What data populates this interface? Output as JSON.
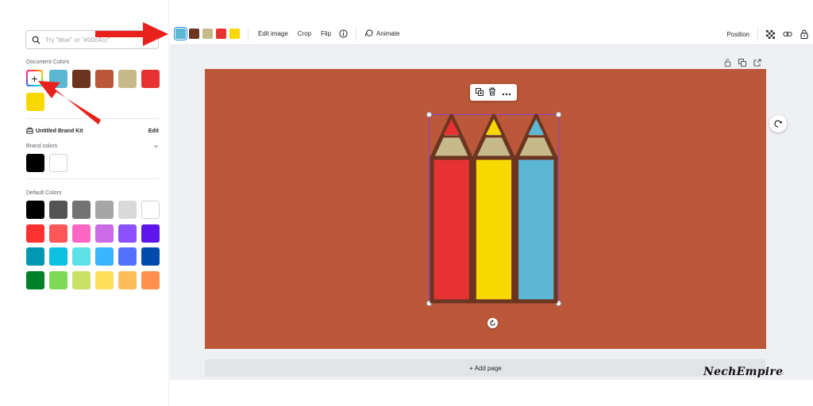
{
  "search": {
    "placeholder": "Try \"blue\" or \"#00c4cc\""
  },
  "left_panel": {
    "document_colors_title": "Document Colors",
    "add_color_symbol": "+",
    "document_colors": [
      "#5cb7d4",
      "#6b3520",
      "#bb5839",
      "#c6b98a",
      "#e63232",
      "#f9d800"
    ],
    "brand_kit_name": "Untitled Brand Kit",
    "brand_kit_edit": "Edit",
    "brand_colors_title": "Brand colors",
    "brand_colors": [
      "#000000",
      "#ffffff"
    ],
    "default_colors_title": "Default Colors",
    "default_colors": [
      [
        "#000000",
        "#545454",
        "#737373",
        "#a6a6a6",
        "#d9d9d9",
        "#ffffff"
      ],
      [
        "#ff3131",
        "#ff5757",
        "#ff66c4",
        "#cb6ce6",
        "#8c52ff",
        "#5e17eb"
      ],
      [
        "#0097b2",
        "#0cc0df",
        "#5ce1e6",
        "#38b6ff",
        "#5271ff",
        "#004aad"
      ],
      [
        "#00802b",
        "#7ed957",
        "#c9e265",
        "#ffde59",
        "#ffbd59",
        "#ff914d"
      ]
    ]
  },
  "toolbar": {
    "swatches": [
      "#5cb7d4",
      "#6b3520",
      "#c6b98a",
      "#e63232",
      "#f9d800"
    ],
    "edit_image": "Edit image",
    "crop": "Crop",
    "flip": "Flip",
    "animate": "Animate",
    "position": "Position"
  },
  "canvas": {
    "background_color": "#bb5839",
    "add_page": "+ Add page"
  },
  "pencils": {
    "outline_color": "#6b3520",
    "wood_color": "#c6b98a",
    "body_colors": [
      "#e63232",
      "#f9d800",
      "#5cb7d4"
    ]
  },
  "watermark": "NechEmpire",
  "annotation_color": "#e8211c"
}
